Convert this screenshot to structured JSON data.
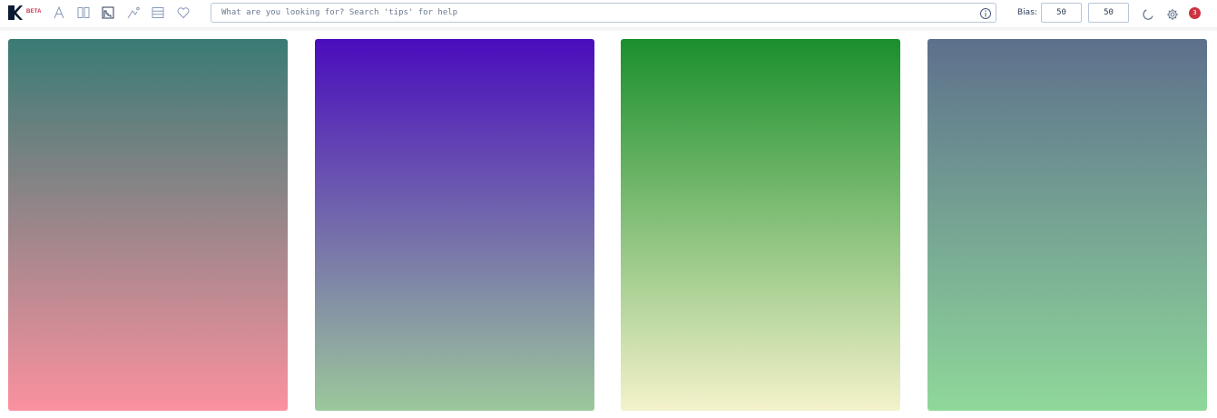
{
  "app": {
    "badge": "BETA",
    "brand_color": "#0b1a33",
    "beta_color": "#c9304d"
  },
  "toolbar": {
    "tools": [
      {
        "icon": "font-icon"
      },
      {
        "icon": "columns-icon"
      },
      {
        "icon": "chart-icon"
      },
      {
        "icon": "sparkle-curve-icon"
      },
      {
        "icon": "rows-icon"
      },
      {
        "icon": "heart-icon"
      }
    ]
  },
  "search": {
    "placeholder": "What are you looking for? Search 'tips' for help",
    "value": ""
  },
  "bias": {
    "label": "Bias:",
    "value_a": "50",
    "value_b": "50"
  },
  "notifications": {
    "count": "3",
    "color": "#cc3340"
  },
  "palettes": [
    {
      "top": "#3a7b75",
      "bottom": "#fb919f"
    },
    {
      "top": "#4a0cbd",
      "bottom": "#9cc89b"
    },
    {
      "top": "#1a8f2c",
      "bottom": "#f4f2ca"
    },
    {
      "top": "#5d708c",
      "bottom": "#8fd89a"
    }
  ]
}
